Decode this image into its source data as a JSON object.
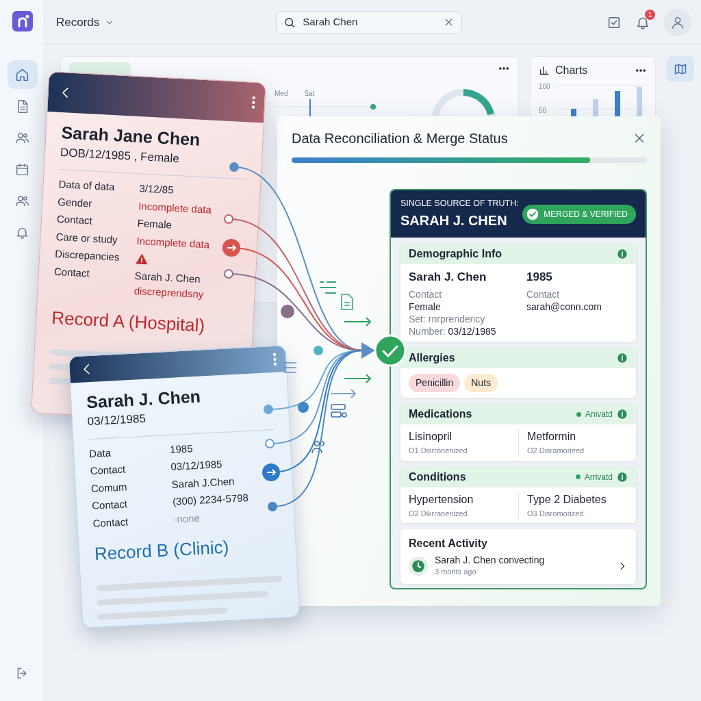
{
  "app": {
    "title": "Records",
    "search": {
      "value": "Sarah Chen"
    },
    "notifications": {
      "count": "1"
    }
  },
  "sidebar": {
    "items": [
      {
        "selected": true
      },
      {
        "selected": false
      },
      {
        "selected": false
      },
      {
        "selected": false
      },
      {
        "selected": false
      },
      {
        "selected": false
      }
    ]
  },
  "dashboard": {
    "panel": {
      "labels": [
        "Med",
        "Sat"
      ]
    },
    "charts_panel": {
      "title": "Charts",
      "axis_labels": [
        "100",
        "50"
      ]
    }
  },
  "records": [
    {
      "name": "Sarah Jane Chen",
      "subtitle": "DOB/12/1985 , Female",
      "title": "Record A (Hospital)",
      "color": "#c0282d",
      "kind": "hospital",
      "rows": [
        {
          "label": "Data of data",
          "kind": "text",
          "value": "3/12/85"
        },
        {
          "label": "Gender",
          "kind": "error",
          "value": "Incomplete data"
        },
        {
          "label": "Contact",
          "kind": "text",
          "value": "Female"
        },
        {
          "label": "Care or study",
          "kind": "error",
          "value": "Incomplete data"
        },
        {
          "label": "Discrepancies",
          "kind": "warning"
        },
        {
          "label": "Contact",
          "kind": "text",
          "value": "Sarah J. Chen",
          "note": "discreprendsny"
        }
      ]
    },
    {
      "name": "Sarah J. Chen",
      "subtitle": "03/12/1985",
      "title": "Record B (Clinic)",
      "color": "#1f6fb2",
      "kind": "clinic",
      "rows": [
        {
          "label": "Data",
          "kind": "text",
          "value": "1985"
        },
        {
          "label": "Contact",
          "kind": "text",
          "value": "03/12/1985"
        },
        {
          "label": "Comum",
          "kind": "text",
          "value": "Sarah J.Chen"
        },
        {
          "label": "Contact",
          "kind": "text",
          "value": "(300) 2234-5798"
        },
        {
          "label": "Contact",
          "kind": "muted",
          "value": "-none"
        }
      ]
    }
  ],
  "modal": {
    "title": "Data Reconciliation & Merge Status",
    "progress": {
      "level": 0.84
    },
    "merged": {
      "kicker": "SINGLE SOURCE OF TRUTH:",
      "name": "SARAH J. CHEN",
      "badge": "MERGED & VERIFIED",
      "sections": [
        {
          "kind": "fields",
          "title": "Demographic Info",
          "columns": [
            [
              {
                "kind": "title",
                "text": "Sarah J. Chen"
              },
              {
                "kind": "label",
                "text": "Contact"
              },
              {
                "kind": "value",
                "text": "Female"
              },
              {
                "kind": "label",
                "text": "Set: rnrprendency"
              },
              {
                "kind": "pair",
                "label": "Number:",
                "text": "03/12/1985"
              }
            ],
            [
              {
                "kind": "title",
                "text": "1985"
              },
              {
                "kind": "label",
                "text": "Contact"
              },
              {
                "kind": "value",
                "text": "sarah@conn.com"
              }
            ]
          ]
        },
        {
          "kind": "tags",
          "title": "Allergies",
          "tags": [
            {
              "text": "Penicillin",
              "color": "#f8d9dc"
            },
            {
              "text": "Nuts",
              "color": "#fdebcf"
            }
          ]
        },
        {
          "kind": "items",
          "title": "Medications",
          "status": "Anivatd",
          "items": [
            {
              "name": "Lisinopril",
              "detail": "O1 Disrroneriized"
            },
            {
              "name": "Metformin",
              "detail": "O2 Disramorieed"
            }
          ]
        },
        {
          "kind": "items",
          "title": "Conditions",
          "status": "Arrivatd",
          "items": [
            {
              "name": "Hypertension",
              "detail": "O2 Dikrraneriized"
            },
            {
              "name": "Type 2 Diabetes",
              "detail": "O3 Disromorized"
            }
          ]
        },
        {
          "kind": "activity",
          "title": "Recent Activity",
          "items": [
            {
              "text": "Sarah J. Chen convecting",
              "time": "3 morits ago"
            }
          ]
        }
      ]
    }
  }
}
